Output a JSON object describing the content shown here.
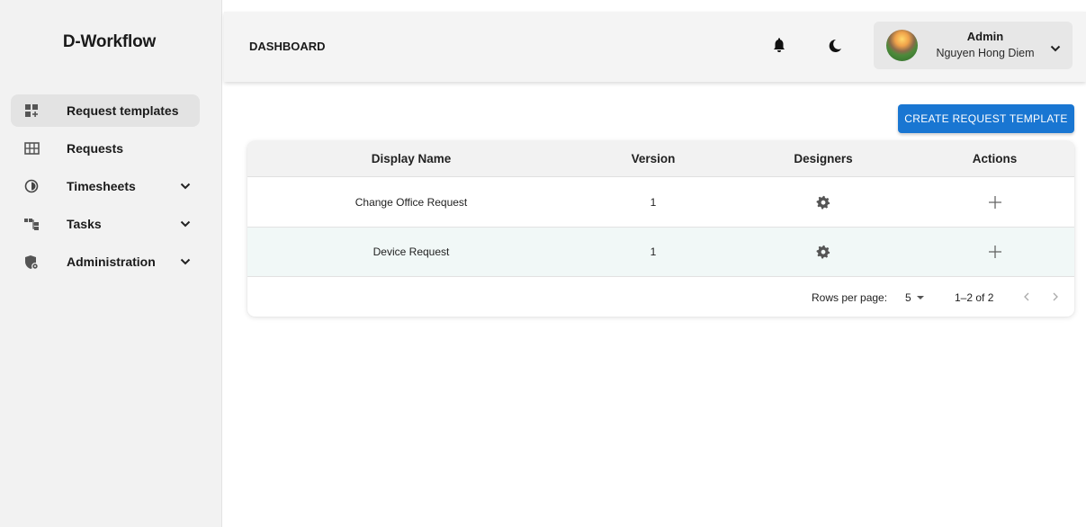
{
  "app": {
    "brand": "D-Workflow"
  },
  "sidebar": {
    "items": [
      {
        "label": "Request templates",
        "icon": "grid-add-icon",
        "active": true,
        "has_chevron": false
      },
      {
        "label": "Requests",
        "icon": "table-icon",
        "active": false,
        "has_chevron": false
      },
      {
        "label": "Timesheets",
        "icon": "clock-icon",
        "active": false,
        "has_chevron": true
      },
      {
        "label": "Tasks",
        "icon": "tree-icon",
        "active": false,
        "has_chevron": true
      },
      {
        "label": "Administration",
        "icon": "shield-icon",
        "active": false,
        "has_chevron": true
      }
    ]
  },
  "header": {
    "title": "DASHBOARD",
    "user": {
      "role": "Admin",
      "name": "Nguyen Hong Diem"
    }
  },
  "toolbar": {
    "create_label": "CREATE REQUEST TEMPLATE"
  },
  "table": {
    "columns": [
      "Display Name",
      "Version",
      "Designers",
      "Actions"
    ],
    "rows": [
      {
        "name": "Change Office Request",
        "version": "1"
      },
      {
        "name": "Device Request",
        "version": "1"
      }
    ],
    "pagination": {
      "rows_per_page_label": "Rows per page:",
      "rows_per_page": "5",
      "range": "1–2 of 2"
    }
  },
  "colors": {
    "primary": "#1976d2",
    "sidebar_bg": "#f2f2f2",
    "alt_row": "#f1f8f7"
  }
}
